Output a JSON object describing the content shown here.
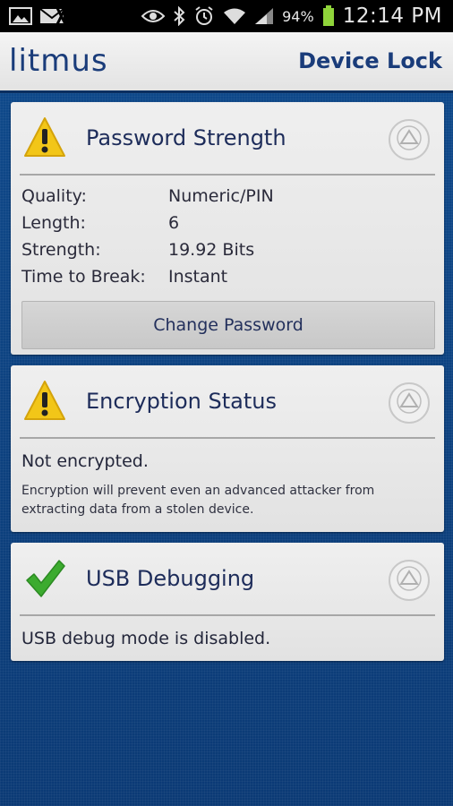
{
  "status_bar": {
    "battery_percent": "94%",
    "time": "12:14 PM",
    "icons": [
      "image-icon",
      "mail-icon",
      "eye-icon",
      "bluetooth-icon",
      "alarm-icon",
      "wifi-icon",
      "signal-icon",
      "battery-icon"
    ]
  },
  "app_bar": {
    "logo_text": "litmus",
    "title": "Device Lock"
  },
  "password_card": {
    "title": "Password Strength",
    "status_icon": "warning-icon",
    "rows": [
      {
        "key": "Quality:",
        "value": "Numeric/PIN"
      },
      {
        "key": "Length:",
        "value": "6"
      },
      {
        "key": "Strength:",
        "value": "19.92 Bits"
      },
      {
        "key": "Time to Break:",
        "value": "Instant"
      }
    ],
    "button_label": "Change Password"
  },
  "encryption_card": {
    "title": "Encryption Status",
    "status_icon": "warning-icon",
    "status_text": "Not encrypted.",
    "note": "Encryption will prevent even an advanced attacker from extracting data from a stolen device."
  },
  "usb_card": {
    "title": "USB Debugging",
    "status_icon": "checkmark-icon",
    "status_text": "USB debug mode is disabled."
  },
  "colors": {
    "background": "#0d3d78",
    "title_text": "#1a3c7a",
    "warning": "#f2c618",
    "check": "#3cab2f"
  }
}
